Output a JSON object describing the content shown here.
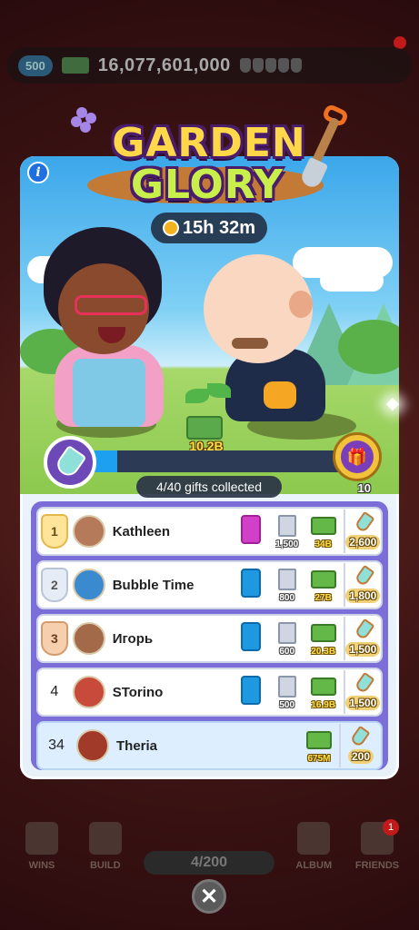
{
  "hud": {
    "dice": "500",
    "cash": "16,077,601,000"
  },
  "event": {
    "title_line1": "GARDEN",
    "title_line2": "GLORY",
    "info_label": "i",
    "timer": "15h 32m",
    "prize_amount": "10.2B",
    "progress": {
      "collected": 4,
      "total": 40,
      "fraction": 0.1
    },
    "gifts_text": "4/40 gifts collected",
    "gift_count": "10"
  },
  "leaderboard": [
    {
      "rank": "1",
      "medal": "gold",
      "name": "Kathleen",
      "pack": "pink",
      "buildings": "1,500",
      "cash": "34B",
      "points": "2,600"
    },
    {
      "rank": "2",
      "medal": "silver",
      "name": "Bubble Time",
      "pack": "blue",
      "buildings": "800",
      "cash": "27B",
      "points": "1,800"
    },
    {
      "rank": "3",
      "medal": "bronze",
      "name": "Игорь",
      "pack": "blue",
      "buildings": "600",
      "cash": "20.3B",
      "points": "1,500"
    },
    {
      "rank": "4",
      "medal": "",
      "name": "STorino",
      "pack": "blue",
      "buildings": "500",
      "cash": "16.9B",
      "points": "1,500"
    }
  ],
  "current_player": {
    "rank": "34",
    "name": "Theria",
    "cash": "675M",
    "points": "200"
  },
  "bottom_nav": {
    "wins": "WINS",
    "build": "BUILD",
    "album": "ALBUM",
    "friends": "FRIENDS",
    "progress": "4/200",
    "friends_badge": "1"
  },
  "close_label": "✕"
}
